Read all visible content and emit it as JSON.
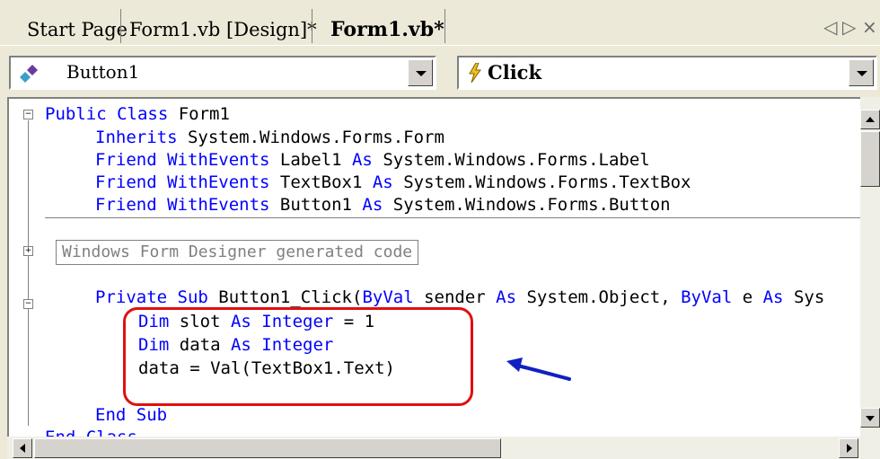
{
  "tabs": [
    {
      "label": "Start Page",
      "active": false
    },
    {
      "label": "Form1.vb [Design]*",
      "active": false
    },
    {
      "label": "Form1.vb*",
      "active": true
    }
  ],
  "nav": {
    "prev": "◁",
    "next": "▷",
    "close": "×"
  },
  "class_combo": {
    "value": "Button1",
    "icon": "class-icon"
  },
  "method_combo": {
    "value": "Click",
    "icon": "lightning-event-icon"
  },
  "code": {
    "line1": {
      "kw": "Public Class",
      "rest": " Form1"
    },
    "line2": {
      "kw": "Inherits",
      "rest": " System.Windows.Forms.Form"
    },
    "line3": {
      "kw1": "Friend WithEvents",
      "mid": " Label1 ",
      "kw2": "As",
      "rest": " System.Windows.Forms.Label"
    },
    "line4": {
      "kw1": "Friend WithEvents",
      "mid": " TextBox1 ",
      "kw2": "As",
      "rest": " System.Windows.Forms.TextBox"
    },
    "line5": {
      "kw1": "Friend WithEvents",
      "mid": " Button1 ",
      "kw2": "As",
      "rest": " System.Windows.Forms.Button"
    },
    "region": "Windows Form Designer generated code",
    "line6": {
      "kw1": "Private Sub",
      "a": " Button1_Click(",
      "kw2": "ByVal",
      "b": " sender ",
      "kw3": "As",
      "c": " System.Object, ",
      "kw4": "ByVal",
      "d": " e ",
      "kw5": "As",
      "e": " Sys"
    },
    "line7": {
      "kw1": "Dim",
      "a": " slot ",
      "kw2": "As Integer",
      "b": " = 1"
    },
    "line8": {
      "kw1": "Dim",
      "a": " data ",
      "kw2": "As Integer"
    },
    "line9": {
      "text": "data = Val(TextBox1.Text)"
    },
    "line10": {
      "kw": "End Sub"
    },
    "line11": {
      "kw": "End Class"
    }
  },
  "colors": {
    "keyword": "#0000ff",
    "highlight": "#e01010",
    "arrow": "#1020c0"
  }
}
